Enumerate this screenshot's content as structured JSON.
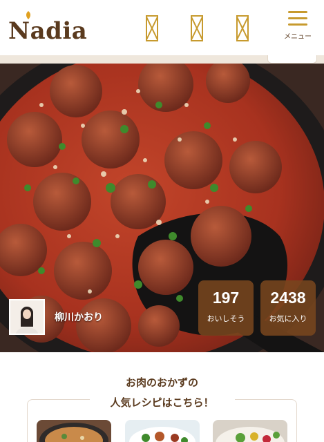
{
  "header": {
    "logo_text": "Nadia",
    "icons": [
      "bookmark-icon",
      "bookmark-icon",
      "bookmark-icon"
    ],
    "menu_label": "メニュー",
    "accent_color": "#c79a2e",
    "brand_color": "#5a3a1e"
  },
  "hero": {
    "author_name": "柳川かおり",
    "stats": [
      {
        "value": "197",
        "label": "おいしそう"
      },
      {
        "value": "2438",
        "label": "お気に入り"
      }
    ]
  },
  "promo": {
    "line1": "お肉のおかずの",
    "line2": "人気レシピはこちら！"
  }
}
